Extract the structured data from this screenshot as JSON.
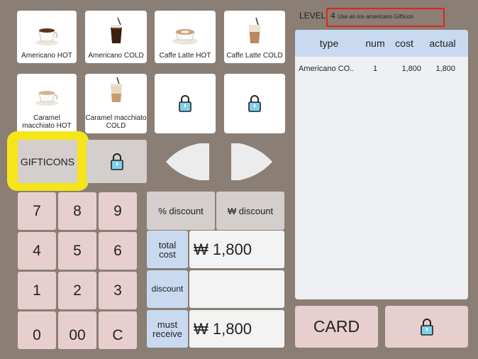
{
  "menu": {
    "items": [
      {
        "label": "Americano HOT",
        "icon": "hot-coffee-cup-icon"
      },
      {
        "label": "Americano COLD",
        "icon": "iced-coffee-glass-icon"
      },
      {
        "label": "Caffe Latte HOT",
        "icon": "latte-cup-icon"
      },
      {
        "label": "Caffe Latte COLD",
        "icon": "iced-latte-glass-icon"
      },
      {
        "label": "Caramel macchiato HOT",
        "icon": "macchiato-cup-icon"
      },
      {
        "label": "Caramel macchiato COLD",
        "icon": "iced-macchiato-glass-icon"
      }
    ],
    "locked_icon": "lock-icon"
  },
  "controls": {
    "gifticons_label": "GIFTICONS",
    "prev_icon": "left-arrow-icon",
    "next_icon": "right-arrow-icon"
  },
  "keypad": {
    "keys": [
      "7",
      "8",
      "9",
      "4",
      "5",
      "6",
      "1",
      "2",
      "3",
      "0",
      "00",
      "C"
    ]
  },
  "discounts": {
    "percent_label": "% discount",
    "won_label": "₩ discount"
  },
  "totals": {
    "total_cost_label": "total cost",
    "total_cost_value": "₩ 1,800",
    "discount_label": "discount",
    "discount_value": "",
    "must_receive_label": "must receive",
    "must_receive_value": "₩ 1,800"
  },
  "level": {
    "prefix": "LEVEL",
    "separator": ": ",
    "number": "4",
    "instruction": "Use an ice americano Gifticon"
  },
  "order": {
    "headers": {
      "type": "type",
      "num": "num",
      "cost": "cost",
      "actual": "actual"
    },
    "rows": [
      {
        "type": "Americano CO..",
        "num": "1",
        "cost": "1,800",
        "actual": "1,800"
      }
    ]
  },
  "payment": {
    "card_label": "CARD"
  },
  "colors": {
    "background": "#8a7e75",
    "highlight_yellow": "#f5e51b",
    "highlight_red": "#e0241b",
    "header_blue": "#c9daf0",
    "key_pink": "#e8cfcf"
  }
}
